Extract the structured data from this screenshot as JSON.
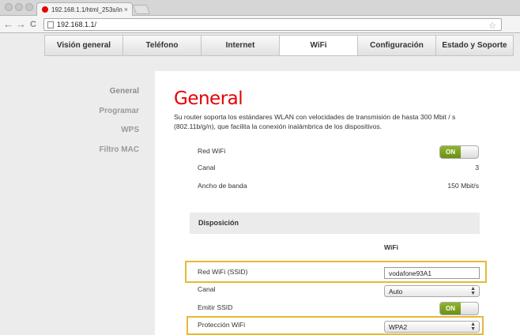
{
  "browser": {
    "tab_title": "192.168.1.1/html_253s/in",
    "tab_close": "×",
    "url": "192.168.1.1/",
    "back": "←",
    "forward": "→",
    "reload": "C",
    "star": "☆"
  },
  "topnav": {
    "tabs": [
      {
        "label": "Visión general"
      },
      {
        "label": "Teléfono"
      },
      {
        "label": "Internet"
      },
      {
        "label": "WiFi"
      },
      {
        "label": "Configuración"
      },
      {
        "label": "Estado y Soporte"
      }
    ],
    "active": "WiFi"
  },
  "sidebar": {
    "items": [
      {
        "label": "General"
      },
      {
        "label": "Programar"
      },
      {
        "label": "WPS"
      },
      {
        "label": "Filtro MAC"
      }
    ]
  },
  "main": {
    "title": "General",
    "description": "Su router soporta los estándares WLAN con velocidades de transmisión de hasta 300 Mbit / s (802.11b/g/n), que facilita la conexión inalámbrica de los dispositivos.",
    "red_wifi_label": "Red WiFi",
    "red_wifi_toggle": "ON",
    "canal_label": "Canal",
    "canal_value": "3",
    "ancho_label": "Ancho de banda",
    "ancho_value": "150 Mbit/s",
    "section_title": "Disposición",
    "column_header": "WiFi",
    "ssid_label": "Red WiFi (SSID)",
    "ssid_value": "vodafone93A1",
    "canal2_label": "Canal",
    "canal2_value": "Auto",
    "emitir_label": "Emitir SSID",
    "emitir_toggle": "ON",
    "proteccion_label": "Protección WiFi",
    "proteccion_value": "WPA2"
  },
  "colors": {
    "accent_red": "#e60000",
    "toggle_green": "#7aa01f",
    "highlight": "#e8b83a"
  }
}
